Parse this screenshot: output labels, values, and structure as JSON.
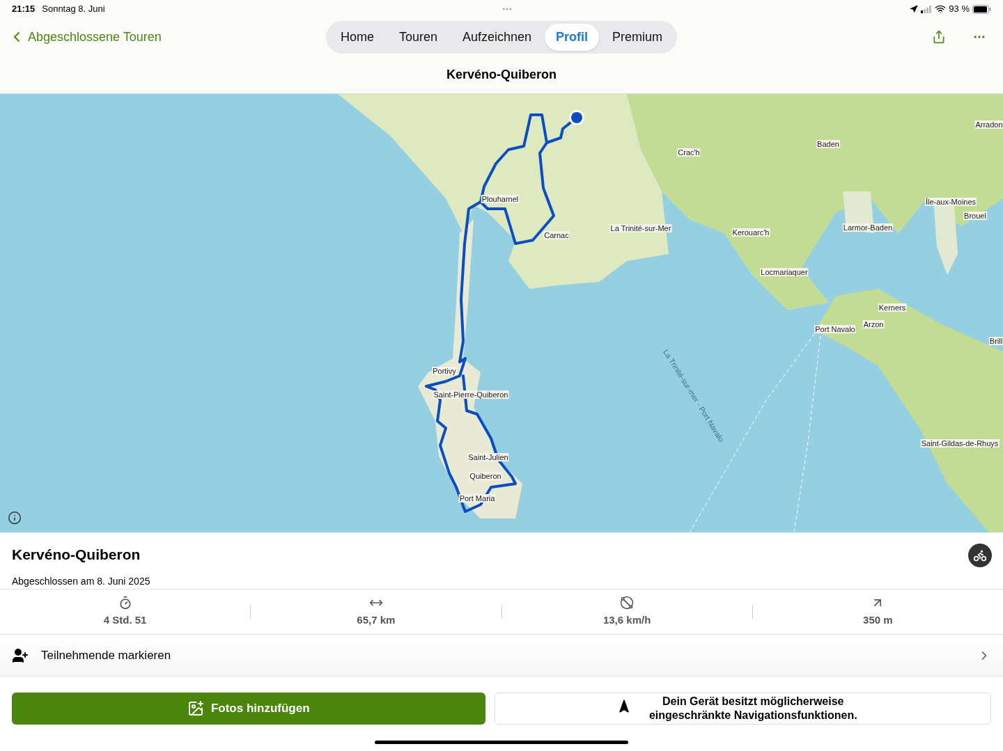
{
  "status_bar": {
    "time": "21:15",
    "date": "Sonntag 8. Juni",
    "battery": "93 %"
  },
  "nav": {
    "back": "Abgeschlossene Touren",
    "tabs": [
      {
        "label": "Home",
        "selected": false
      },
      {
        "label": "Touren",
        "selected": false
      },
      {
        "label": "Aufzeichnen",
        "selected": false
      },
      {
        "label": "Profil",
        "selected": true
      },
      {
        "label": "Premium",
        "selected": false
      }
    ],
    "title": "Kervéno-Quiberon"
  },
  "map": {
    "labels": [
      "Plouharnel",
      "Carnac",
      "La Trinité-sur-Mer",
      "Crac'h",
      "Baden",
      "Arradon",
      "Île-aux-Moines",
      "Brouel",
      "Larmor-Baden",
      "Kerouarc'h",
      "Locmariaquer",
      "Kerners",
      "Arzon",
      "Port Navalo",
      "Brill",
      "Portivy",
      "Saint-Pierre-Quiberon",
      "Saint-Julien",
      "Quiberon",
      "Port Maria",
      "Saint-Gildas-de-Rhuys"
    ],
    "ferry_label": "La Trinité-sur-mer - Port Navalo"
  },
  "tour": {
    "title": "Kervéno-Quiberon",
    "subtitle": "Abgeschlossen am 8. Juni 2025"
  },
  "stats": [
    {
      "kind": "duration",
      "value": "4 Std. 51"
    },
    {
      "kind": "distance",
      "value": "65,7 km"
    },
    {
      "kind": "speed",
      "value": "13,6 km/h"
    },
    {
      "kind": "ascent",
      "value": "350 m"
    }
  ],
  "participants": "Teilnehmende markieren",
  "buttons": {
    "photos": "Fotos hinzufügen",
    "notice": "Dein Gerät besitzt möglicherweise eingeschränkte Navigationsfunktionen."
  }
}
